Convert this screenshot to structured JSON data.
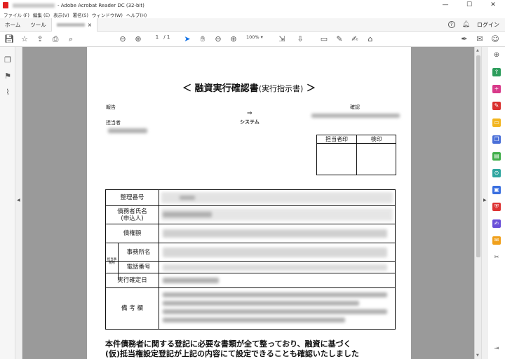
{
  "window": {
    "title": "- Adobe Acrobat Reader DC (32-bit)",
    "controls": [
      "—",
      "☐",
      "✕"
    ]
  },
  "menu": [
    "ファイル (F)",
    "編集 (E)",
    "表示(V)",
    "署名(S)",
    "ウィンドウ(W)",
    "ヘルプ(H)"
  ],
  "tabs": {
    "home": "ホーム",
    "tools": "ツール",
    "doc_close": "×"
  },
  "header_right": {
    "help": "?",
    "login": "ログイン"
  },
  "toolbar": {
    "page_current": "1",
    "page_sep": "/",
    "page_total": "1",
    "zoom": "100%"
  },
  "document": {
    "title_main": "＜ 融資実行確認書",
    "title_sub": "(実行指示書)",
    "title_end": "＞",
    "report_label": "報告",
    "confirm_label": "確認",
    "arrow": "⇒",
    "system_label": "システム",
    "person_label": "担当者",
    "stamp_headers": [
      "担当者印",
      "検印"
    ],
    "rows": [
      {
        "label": "整理番号"
      },
      {
        "label": "債務者氏名\n(申込人)"
      },
      {
        "label": "債権額"
      },
      {
        "label": "事務所名",
        "sub": "担当事務所"
      },
      {
        "label": "電話番号"
      },
      {
        "label": "実行確定日"
      },
      {
        "label": "備 考 欄"
      }
    ],
    "footer_line1": "本件債務者に関する登記に必要な書類が全て整っており、融資に基づく",
    "footer_line2": "(仮)抵当権設定登記が上記の内容にて設定できることも確認いたしました"
  }
}
